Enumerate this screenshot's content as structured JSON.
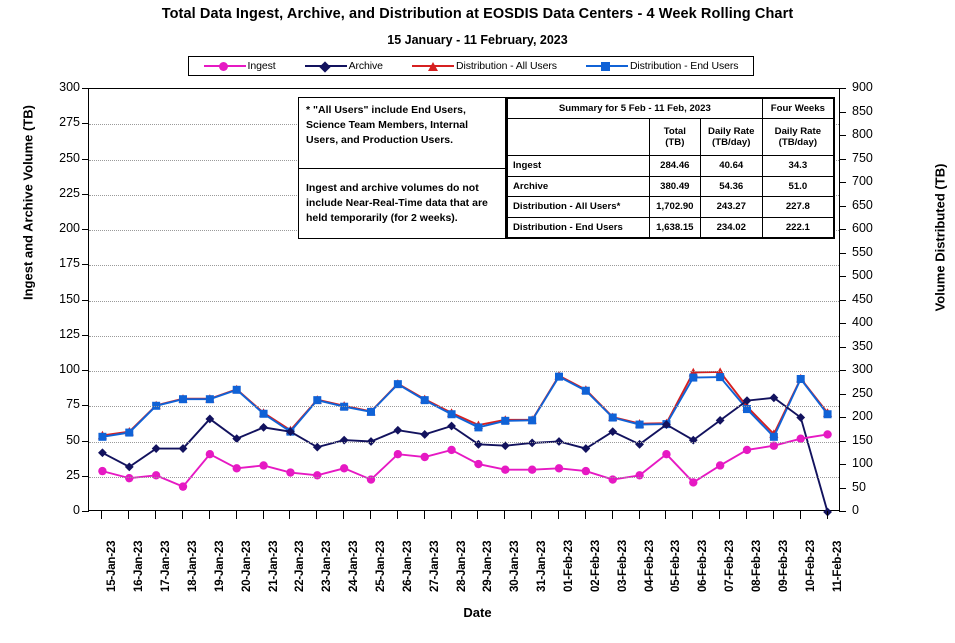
{
  "chart_title": "Total Data Ingest, Archive, and  Distribution at EOSDIS Data Centers - 4 Week Rolling Chart",
  "chart_subtitle": "15  January  -  11 February,  2023",
  "axis": {
    "x_title": "Date",
    "y_left_title": "Ingest and Archive Volume (TB)",
    "y_right_title": "Volume Distributed (TB)"
  },
  "legend": {
    "items": [
      {
        "label": "Ingest",
        "color": "#e619c3",
        "marker": "circle"
      },
      {
        "label": "Archive",
        "color": "#12125e",
        "marker": "diamond"
      },
      {
        "label": "Distribution - All Users",
        "color": "#d62020",
        "marker": "triangle"
      },
      {
        "label": "Distribution - End Users",
        "color": "#1062d6",
        "marker": "square"
      }
    ]
  },
  "notes": {
    "footnote": "* \"All Users\" include End Users,  Science Team Members,  Internal Users, and Production Users.",
    "nrt_note": "Ingest and archive volumes do not include Near-Real-Time data that are held temporarily (for 2 weeks)."
  },
  "summary_table": {
    "title": "Summary for  5 Feb  -  11 Feb,  2023",
    "four_weeks_header": "Four Weeks",
    "col_headers": [
      "",
      "Total\n(TB)",
      "Daily Rate\n(TB/day)",
      "Daily Rate\n(TB/day)"
    ],
    "col_total_line1": "Total",
    "col_total_line2": "(TB)",
    "col_daily_line1": "Daily Rate",
    "col_daily_line2": "(TB/day)",
    "col_fw_line1": "Daily Rate",
    "col_fw_line2": "(TB/day)",
    "rows": [
      {
        "name": "Ingest",
        "total": "284.46",
        "daily_rate": "40.64",
        "four_week_rate": "34.3"
      },
      {
        "name": "Archive",
        "total": "380.49",
        "daily_rate": "54.36",
        "four_week_rate": "51.0"
      },
      {
        "name": "Distribution - All Users*",
        "total": "1,702.90",
        "daily_rate": "243.27",
        "four_week_rate": "227.8"
      },
      {
        "name": "Distribution - End Users",
        "total": "1,638.15",
        "daily_rate": "234.02",
        "four_week_rate": "222.1"
      }
    ]
  },
  "chart_data": {
    "type": "line",
    "title": "Total Data Ingest, Archive, and  Distribution at EOSDIS Data Centers - 4 Week Rolling Chart",
    "subtitle": "15  January  -  11 February,  2023",
    "xlabel": "Date",
    "ylabel": "Ingest and Archive Volume (TB)",
    "y2label": "Volume Distributed (TB)",
    "ylim": [
      0,
      300
    ],
    "y2lim": [
      0,
      900
    ],
    "ytick_step": 25,
    "y2tick_step": 50,
    "grid": true,
    "legend_position": "top",
    "categories": [
      "15-Jan-23",
      "16-Jan-23",
      "17-Jan-23",
      "18-Jan-23",
      "19-Jan-23",
      "20-Jan-23",
      "21-Jan-23",
      "22-Jan-23",
      "23-Jan-23",
      "24-Jan-23",
      "25-Jan-23",
      "26-Jan-23",
      "27-Jan-23",
      "28-Jan-23",
      "29-Jan-23",
      "30-Jan-23",
      "31-Jan-23",
      "01-Feb-23",
      "02-Feb-23",
      "03-Feb-23",
      "04-Feb-23",
      "05-Feb-23",
      "06-Feb-23",
      "07-Feb-23",
      "08-Feb-23",
      "09-Feb-23",
      "10-Feb-23",
      "11-Feb-23"
    ],
    "yticks": [
      0,
      25,
      50,
      75,
      100,
      125,
      150,
      175,
      200,
      225,
      250,
      275,
      300
    ],
    "y2ticks": [
      0,
      50,
      100,
      150,
      200,
      250,
      300,
      350,
      400,
      450,
      500,
      550,
      600,
      650,
      700,
      750,
      800,
      850,
      900
    ],
    "series": [
      {
        "name": "Ingest",
        "axis": "left",
        "color": "#e619c3",
        "marker": "circle",
        "values": [
          29,
          24,
          26,
          18,
          41,
          31,
          33,
          28,
          26,
          31,
          23,
          41,
          39,
          44,
          34,
          30,
          30,
          31,
          29,
          23,
          26,
          41,
          21,
          33,
          44,
          47,
          52,
          55
        ]
      },
      {
        "name": "Archive",
        "axis": "left",
        "color": "#12125e",
        "marker": "diamond",
        "values": [
          42,
          32,
          45,
          45,
          66,
          52,
          60,
          57,
          46,
          51,
          50,
          58,
          55,
          61,
          48,
          47,
          49,
          50,
          45,
          57,
          48,
          62,
          51,
          65,
          79,
          81,
          67,
          0
        ]
      },
      {
        "name": "Distribution - All Users",
        "axis": "right",
        "color": "#d62020",
        "marker": "triangle",
        "values": [
          163,
          171,
          227,
          241,
          241,
          261,
          211,
          174,
          239,
          226,
          214,
          273,
          240,
          211,
          185,
          196,
          196,
          290,
          260,
          202,
          188,
          189,
          297,
          298,
          224,
          166,
          284,
          211
        ]
      },
      {
        "name": "Distribution - End Users",
        "axis": "right",
        "color": "#1062d6",
        "marker": "square",
        "values": [
          160,
          169,
          226,
          240,
          240,
          260,
          209,
          171,
          238,
          224,
          213,
          272,
          238,
          208,
          180,
          194,
          195,
          288,
          258,
          201,
          186,
          187,
          286,
          287,
          219,
          160,
          283,
          208
        ]
      }
    ]
  }
}
